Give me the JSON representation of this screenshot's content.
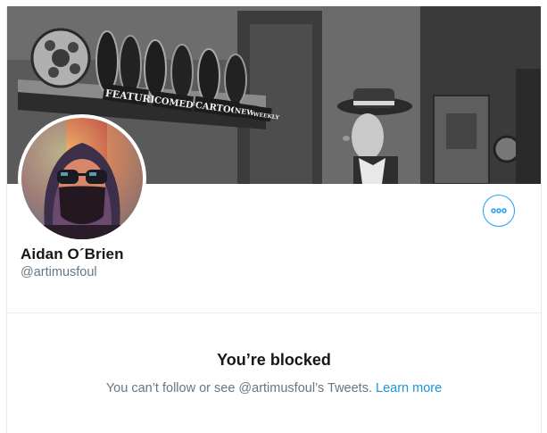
{
  "profile": {
    "display_name": "Aidan O´Brien",
    "handle": "@artimusfoul"
  },
  "banner": {
    "reel_labels": [
      "FEATURE",
      "COMEDY",
      "CARTOON",
      "NEWS",
      "WEEKLY"
    ]
  },
  "actions": {
    "more_icon": "more-dots-icon"
  },
  "blocked": {
    "title": "You’re blocked",
    "message": "You can’t follow or see @artimusfoul’s Tweets.",
    "link_label": "Learn more"
  },
  "colors": {
    "accent": "#1da1f2",
    "link": "#1b95e0",
    "primary_text": "#14171a",
    "secondary_text": "#657786",
    "border": "#e6ecf0"
  }
}
